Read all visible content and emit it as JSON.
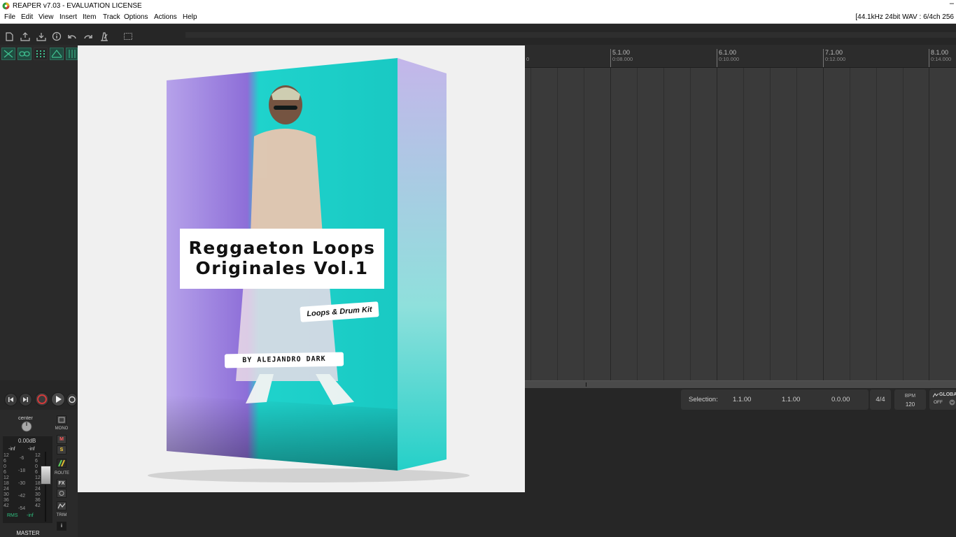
{
  "window": {
    "title": "REAPER v7.03 - EVALUATION LICENSE",
    "minimize_glyph": "–"
  },
  "menu": {
    "items": [
      "File",
      "Edit",
      "View",
      "Insert",
      "Item",
      "Track",
      "Options",
      "Actions",
      "Help"
    ],
    "status": "[44.1kHz 24bit WAV : 6/4ch 256"
  },
  "ruler": {
    "marks": [
      {
        "bar": "5.1.00",
        "time": "0:08.000"
      },
      {
        "bar": "6.1.00",
        "time": "0:10.000"
      },
      {
        "bar": "7.1.00",
        "time": "0:12.000"
      },
      {
        "bar": "8.1.00",
        "time": "0:14.000"
      }
    ],
    "partial_time": "0"
  },
  "selection": {
    "label": "Selection:",
    "start": "1.1.00",
    "end": "1.1.00",
    "length": "0.0.00"
  },
  "timesig": "4/4",
  "tempo": {
    "label": "BPM",
    "value": "120"
  },
  "global": {
    "label": "GLOBAL",
    "value": "OFF"
  },
  "master": {
    "pan": "center",
    "volume": "0.00dB",
    "peak_left": "-inf",
    "peak_right": "-inf",
    "scale_left": [
      "12",
      "6",
      "0",
      "6",
      "12",
      "18",
      "24",
      "30",
      "36",
      "42"
    ],
    "scale_mid": [
      "-6",
      "-18",
      "-30",
      "-42",
      "-54"
    ],
    "scale_right": [
      "12",
      "6",
      "0",
      "6",
      "12",
      "18",
      "24",
      "30",
      "36",
      "42"
    ],
    "rms_label": "RMS",
    "rms_value": "-inf",
    "name": "MASTER",
    "buttons": {
      "mono": "MONO",
      "mute": "M",
      "solo": "S",
      "route": "ROUTE",
      "fx": "FX",
      "trim": "TRIM",
      "info": "i"
    }
  },
  "cover": {
    "title_line1": "Reggaeton Loops",
    "title_line2": "Originales Vol.1",
    "subtitle": "Loops & Drum Kit",
    "author": "BY ALEJANDRO DARK"
  },
  "colors": {
    "accent_green": "#2e6d5a",
    "record_red": "#d33a3a",
    "cover_purple": "#8d6ed8",
    "cover_teal": "#1fd3cc"
  },
  "icons": {
    "toolbar": [
      "new-project-icon",
      "open-project-icon",
      "save-project-icon",
      "project-settings-icon",
      "undo-icon",
      "redo-icon",
      "metronome-icon",
      "grid-icon"
    ],
    "transport": [
      "go-to-start-icon",
      "go-to-end-icon",
      "record-icon",
      "play-icon",
      "repeat-icon"
    ]
  }
}
